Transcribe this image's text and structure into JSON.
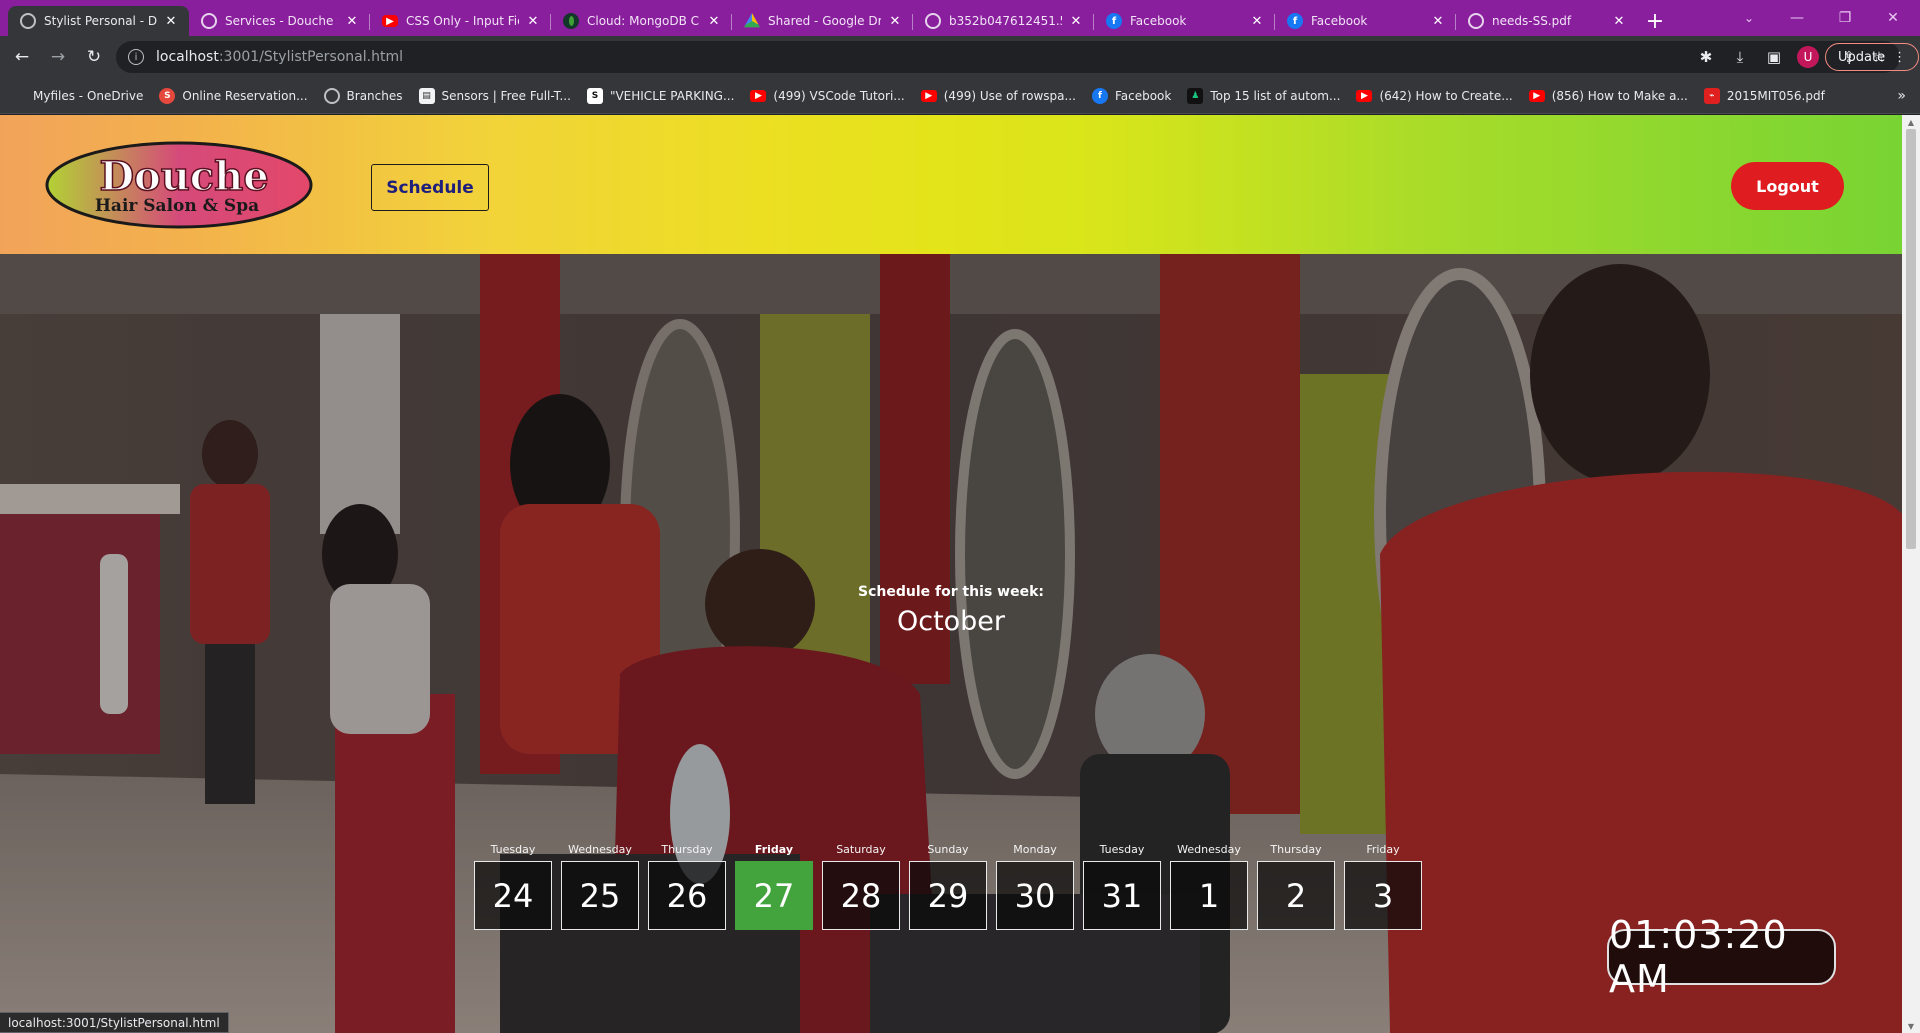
{
  "browser": {
    "tabs": [
      {
        "title": "Stylist Personal - Do",
        "favicon": "globe-icon",
        "active": true
      },
      {
        "title": "Services - Douche S",
        "favicon": "globe-icon"
      },
      {
        "title": "CSS Only - Input Fie",
        "favicon": "youtube-icon"
      },
      {
        "title": "Cloud: MongoDB Cl",
        "favicon": "mongodb-leaf-icon"
      },
      {
        "title": "Shared - Google Dri",
        "favicon": "google-drive-icon"
      },
      {
        "title": "b352b047612451.5",
        "favicon": "globe-icon"
      },
      {
        "title": "Facebook",
        "favicon": "facebook-icon"
      },
      {
        "title": "Facebook",
        "favicon": "facebook-icon"
      },
      {
        "title": "needs-SS.pdf",
        "favicon": "globe-icon"
      }
    ],
    "url_host": "localhost",
    "url_path": ":3001/StylistPersonal.html",
    "update_label": "Update",
    "avatar_letter": "U",
    "bookmarks": [
      {
        "label": "Myfiles - OneDrive",
        "icon": "onedrive-icon"
      },
      {
        "label": "Online Reservation...",
        "icon": "s-logo-icon"
      },
      {
        "label": "Branches",
        "icon": "globe-icon"
      },
      {
        "label": "Sensors | Free Full-T...",
        "icon": "page-icon"
      },
      {
        "label": "\"VEHICLE PARKING...",
        "icon": "s-arrow-icon"
      },
      {
        "label": "(499) VSCode Tutori...",
        "icon": "youtube-icon"
      },
      {
        "label": "(499) Use of rowspa...",
        "icon": "youtube-icon"
      },
      {
        "label": "Facebook",
        "icon": "facebook-icon"
      },
      {
        "label": "Top 15 list of autom...",
        "icon": "bot-icon"
      },
      {
        "label": "(642) How to Create...",
        "icon": "youtube-icon"
      },
      {
        "label": "(856) How to Make a...",
        "icon": "youtube-icon"
      },
      {
        "label": "2015MIT056.pdf",
        "icon": "pdf-icon"
      }
    ],
    "status_url": "localhost:3001/StylistPersonal.html"
  },
  "site": {
    "logo_line1": "Douche",
    "logo_line2": "Hair Salon & Spa",
    "nav_schedule": "Schedule",
    "logout": "Logout"
  },
  "schedule": {
    "label": "Schedule for this week:",
    "month": "October",
    "days": [
      {
        "name": "Tuesday",
        "num": "24"
      },
      {
        "name": "Wednesday",
        "num": "25"
      },
      {
        "name": "Thursday",
        "num": "26"
      },
      {
        "name": "Friday",
        "num": "27",
        "today": true
      },
      {
        "name": "Saturday",
        "num": "28"
      },
      {
        "name": "Sunday",
        "num": "29"
      },
      {
        "name": "Monday",
        "num": "30"
      },
      {
        "name": "Tuesday",
        "num": "31"
      },
      {
        "name": "Wednesday",
        "num": "1"
      },
      {
        "name": "Thursday",
        "num": "2"
      },
      {
        "name": "Friday",
        "num": "3"
      }
    ]
  },
  "clock": "01:03:20 AM",
  "colors": {
    "tabbar": "#8a1f9e",
    "chrome": "#35363a",
    "logout": "#df1d21",
    "today": "#43a33d",
    "nav_text": "#1e1e7d"
  }
}
